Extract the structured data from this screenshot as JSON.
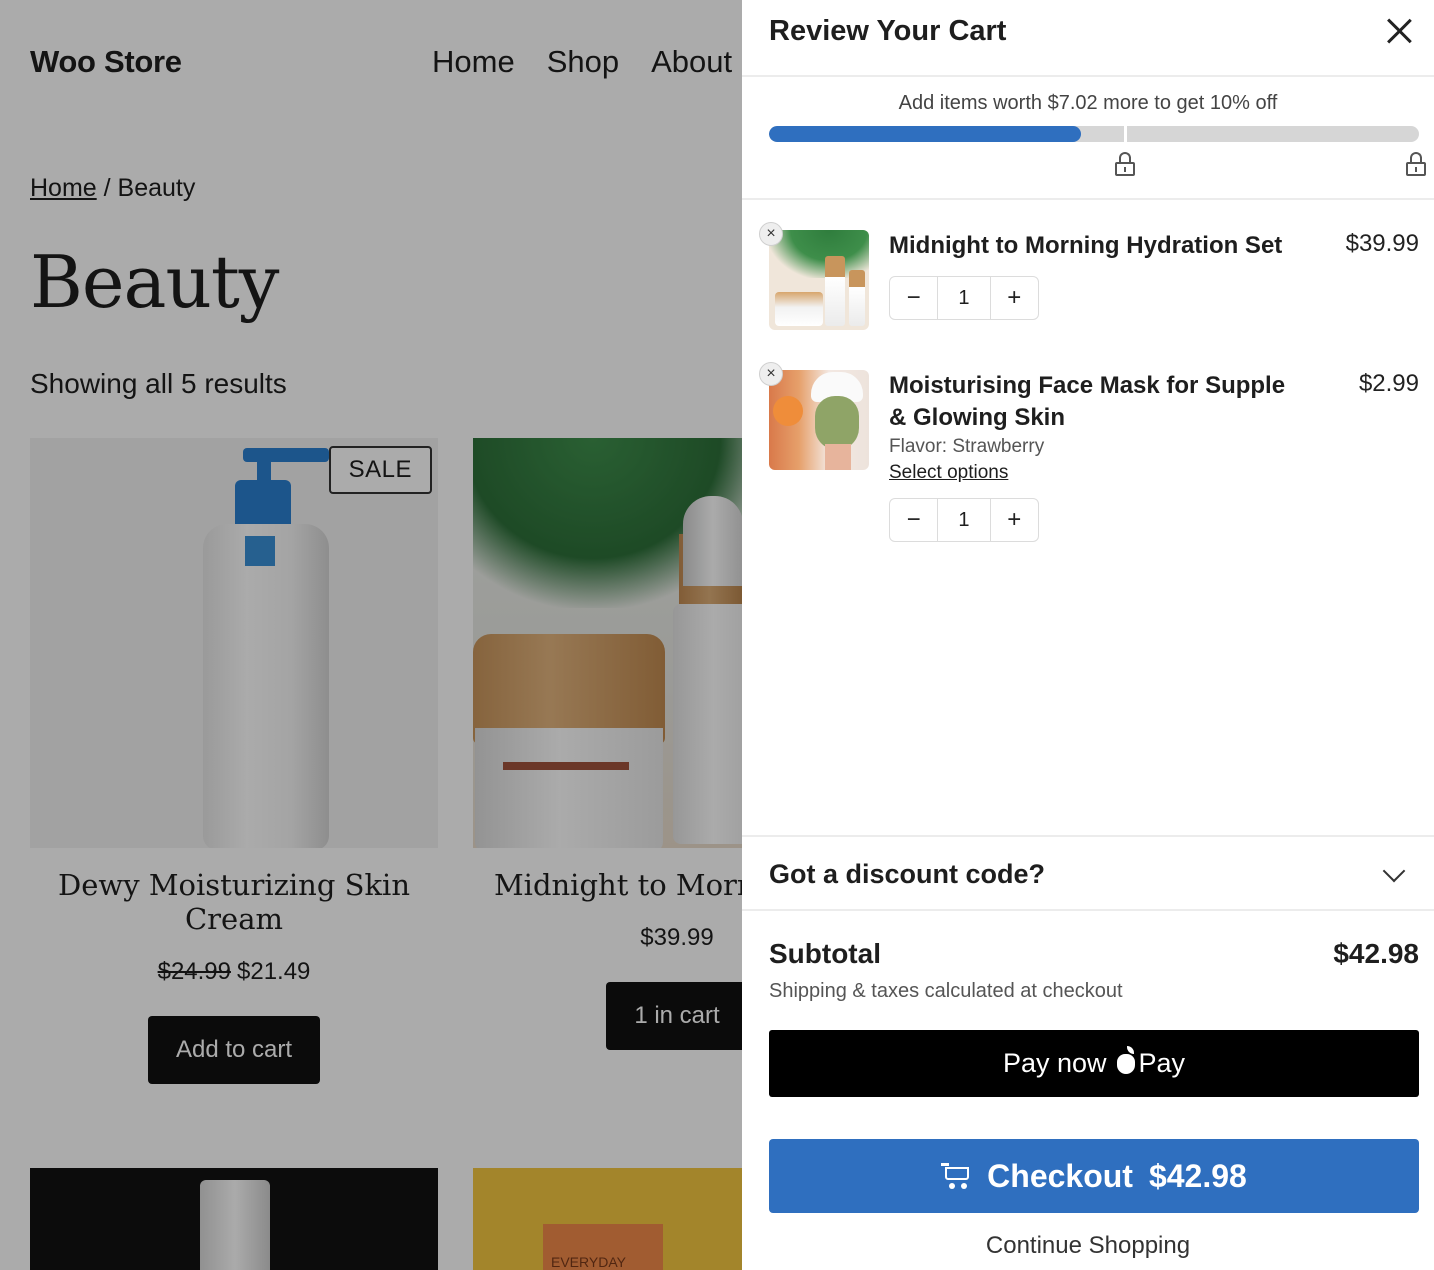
{
  "store": {
    "brand": "Woo Store",
    "nav": [
      "Home",
      "Shop",
      "About U"
    ],
    "breadcrumb": {
      "home": "Home",
      "separator": " / ",
      "current": "Beauty"
    },
    "page_title": "Beauty",
    "result_count": "Showing all 5 results",
    "products": [
      {
        "name": "Dewy Moisturizing Skin Cream",
        "old_price": "$24.99",
        "price": "$21.49",
        "badge": "SALE",
        "button": "Add to cart"
      },
      {
        "name": "Midnight to Morning Set",
        "price": "$39.99",
        "button": "1 in cart"
      }
    ],
    "row2_box_text": "EVERYDAY"
  },
  "cart": {
    "title": "Review Your Cart",
    "progress": {
      "message": "Add items worth $7.02 more to get 10% off",
      "fill_percent": 48
    },
    "items": [
      {
        "name": "Midnight to Morning Hydration Set",
        "price": "$39.99",
        "qty": "1",
        "remove": "×",
        "minus": "−",
        "plus": "+"
      },
      {
        "name": "Moisturising Face Mask for Supple & Glowing Skin",
        "price": "$2.99",
        "variant": "Flavor: Strawberry",
        "select_options": "Select options",
        "qty": "1",
        "remove": "×",
        "minus": "−",
        "plus": "+"
      }
    ],
    "discount_label": "Got a discount code?",
    "subtotal_label": "Subtotal",
    "subtotal_value": "$42.98",
    "subtotal_note": "Shipping & taxes calculated at checkout",
    "apple_pay": {
      "pay_now": "Pay now",
      "pay": "Pay"
    },
    "checkout": {
      "label": "Checkout",
      "amount": "$42.98"
    },
    "continue_shopping": "Continue Shopping",
    "colors": {
      "accent": "#2f6fbf",
      "progress_track": "#d6d6d6"
    }
  }
}
